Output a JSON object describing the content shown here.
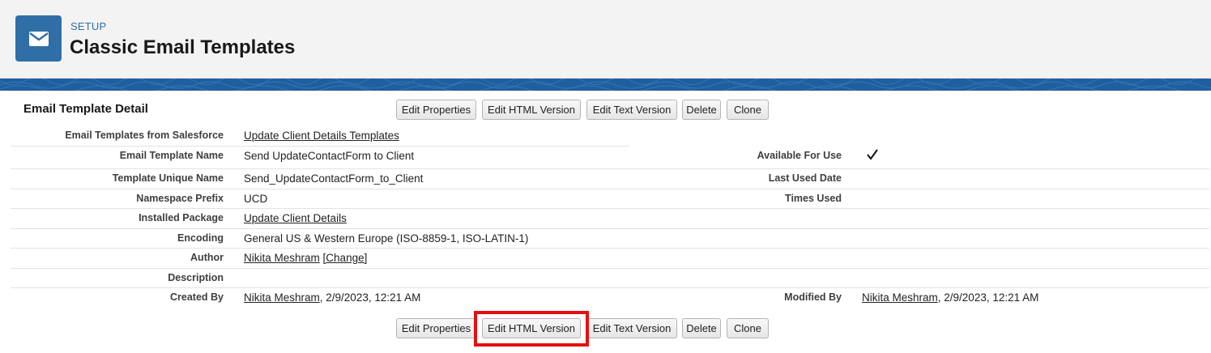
{
  "header": {
    "eyebrow": "SETUP",
    "title": "Classic Email Templates",
    "icon": "envelope-icon",
    "accent": "#2f6fa6"
  },
  "panel": {
    "title": "Email Template Detail"
  },
  "buttons": {
    "edit_properties": "Edit Properties",
    "edit_html": "Edit HTML Version",
    "edit_text": "Edit Text Version",
    "delete": "Delete",
    "clone": "Clone"
  },
  "fields": {
    "email_templates_from": {
      "label": "Email Templates from Salesforce",
      "value": "Update Client Details Templates"
    },
    "template_name": {
      "label": "Email Template Name",
      "value": "Send UpdateContactForm to Client"
    },
    "unique_name": {
      "label": "Template Unique Name",
      "value": "Send_UpdateContactForm_to_Client"
    },
    "namespace": {
      "label": "Namespace Prefix",
      "value": "UCD"
    },
    "package": {
      "label": "Installed Package",
      "value": "Update Client Details"
    },
    "encoding": {
      "label": "Encoding",
      "value": "General US & Western Europe (ISO-8859-1, ISO-LATIN-1)"
    },
    "author": {
      "label": "Author",
      "value": "Nikita Meshram",
      "change": "[Change]"
    },
    "description": {
      "label": "Description",
      "value": ""
    },
    "created_by": {
      "label": "Created By",
      "user": "Nikita Meshram",
      "date": ", 2/9/2023, 12:21 AM"
    },
    "available": {
      "label": "Available For Use",
      "checked": true,
      "icon": "checkmark-icon"
    },
    "last_used": {
      "label": "Last Used Date",
      "value": ""
    },
    "times_used": {
      "label": "Times Used",
      "value": ""
    },
    "modified_by": {
      "label": "Modified By",
      "user": "Nikita Meshram",
      "date": ", 2/9/2023, 12:21 AM"
    }
  },
  "highlight_color": "#e41010"
}
